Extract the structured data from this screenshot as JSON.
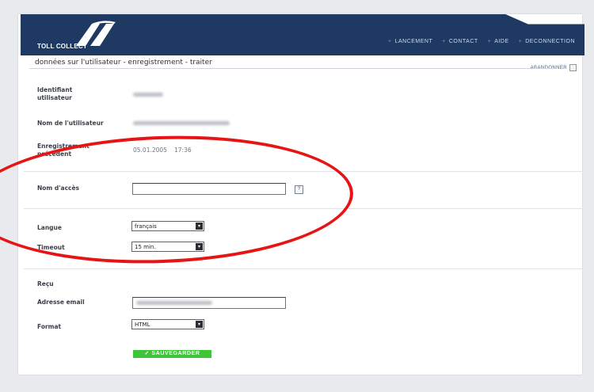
{
  "brand": {
    "name": "TOLL COLLECT"
  },
  "nav": {
    "items": [
      {
        "label": "LANCEMENT"
      },
      {
        "label": "CONTACT"
      },
      {
        "label": "AIDE"
      },
      {
        "label": "DECONNECTION"
      }
    ]
  },
  "breadcrumb": "données sur l'utilisateur - enregistrement - traiter",
  "cancel_label": "ABANDONNER",
  "fields": {
    "identifiant_label_1": "Identifiant",
    "identifiant_label_2": "utilisateur",
    "nom_label": "Nom de l'utilisateur",
    "enreg_label_1": "Enregistrement",
    "enreg_label_2": "précédent",
    "enreg_date": "05.01.2005",
    "enreg_time": "17:36",
    "nom_acces_label": "Nom d'accès",
    "nom_acces_value": "",
    "help_icon_label": "?",
    "langue_label": "Langue",
    "langue_value": "français",
    "timeout_label": "Timeout",
    "timeout_value": "15 min.",
    "recu_label": "Reçu",
    "email_label": "Adresse email",
    "format_label": "Format",
    "format_value": "HTML",
    "save_label": "SAUVEGARDER"
  },
  "colors": {
    "header": "#1e3a62",
    "save_button": "#3fc53a",
    "highlight_circle": "#e61414"
  },
  "icons": [
    "toll-collect-logo-icon",
    "help-icon",
    "dropdown-arrow-icon",
    "cancel-icon",
    "check-icon"
  ]
}
